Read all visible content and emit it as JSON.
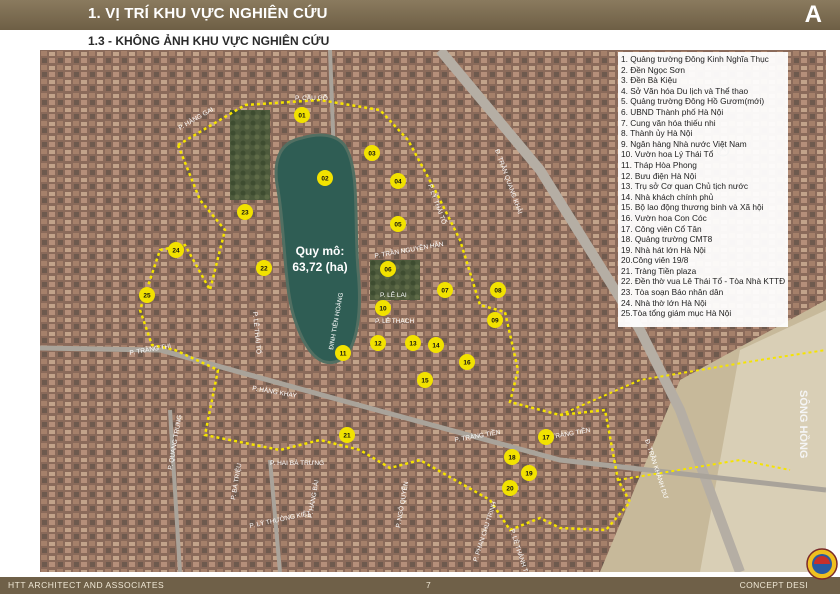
{
  "header": {
    "title": "1. VỊ TRÍ KHU VỰC NGHIÊN CỨU",
    "letter": "A"
  },
  "subtitle": "1.3 - KHÔNG ẢNH KHU VỰC NGHIÊN CỨU",
  "map": {
    "area_label": "Quy mô:",
    "area_value": "63,72 (ha)",
    "river_label": "SÔNG HỒNG",
    "street_labels": [
      "P. CẦU GỖ",
      "P. HÀNG GAI",
      "Đ. TRẦN QUANG KHẢI",
      "P. LÝ THÁI TỔ",
      "P. TRẦN NGUYÊN HÃN",
      "P. LÊ LAI",
      "P. LÊ THẠCH",
      "P. LÊ THÁI TỔ",
      "P. TRÀNG THI",
      "P. HÀNG KHAY",
      "ĐINH TIÊN HOÀNG",
      "P. TRÀNG TIỀN",
      "P. HAI BÀ TRƯNG",
      "P. BÀ TRIỆU",
      "P. HÀNG BÀI",
      "P. QUANG TRUNG",
      "P. LÝ THƯỜNG KIỆT",
      "P. NGÔ QUYỀN",
      "P. PHAN CHU TRINH",
      "P. LÊ THÁNH TÔNG",
      "Đ. TRẦN KHÁNH DƯ",
      "P. TRÀNG TIỀN"
    ],
    "markers": [
      "01",
      "02",
      "03",
      "04",
      "05",
      "06",
      "07",
      "08",
      "09",
      "10",
      "11",
      "12",
      "13",
      "14",
      "15",
      "16",
      "17",
      "18",
      "19",
      "20",
      "21",
      "22",
      "23",
      "24",
      "25"
    ],
    "legend": [
      "1.   Quảng trường Đông Kinh Nghĩa Thục",
      "2.   Đền Ngọc Sơn",
      "3.   Đền Bà Kiệu",
      "4.   Sở Văn hóa Du lịch và Thể thao",
      "5.   Quảng trường Đông Hồ Gươm(mới)",
      "6.   UBND Thành phố Hà Nội",
      "7.   Cung văn hóa thiếu nhi",
      "8.   Thành ủy Hà Nội",
      "9.   Ngân hàng Nhà nước Việt Nam",
      "10. Vườn hoa Lý Thái Tổ",
      "11. Tháp Hòa Phong",
      "12. Bưu điện Hà Nội",
      "13. Trụ sở Cơ quan Chủ tịch nước",
      "14. Nhà khách chính phủ",
      "15. Bộ lao động thương binh và Xã hội",
      "16. Vườn hoa Con Cóc",
      "17. Công viên Cổ Tân",
      "18. Quảng trường CMT8",
      "19. Nhà hát lớn Hà Nội",
      "20.Công viên 19/8",
      "21. Tràng Tiền plaza",
      "22. Đền thờ vua Lê Thái Tổ - Tòa Nhà KTTĐ",
      "23. Tòa soạn Báo nhân dân",
      "24. Nhà thờ lớn Hà Nội",
      "25.Tòa tổng giám mục Hà Nội"
    ]
  },
  "footer": {
    "left": "HTT ARCHITECT AND ASSOCIATES",
    "page": "7",
    "right": "CONCEPT DESI"
  },
  "colors": {
    "header": "#7a6b50",
    "boundary": "#f5e400",
    "lake": "#2f5d54",
    "river": "#d9cfb6",
    "marker": "#f2e200"
  }
}
